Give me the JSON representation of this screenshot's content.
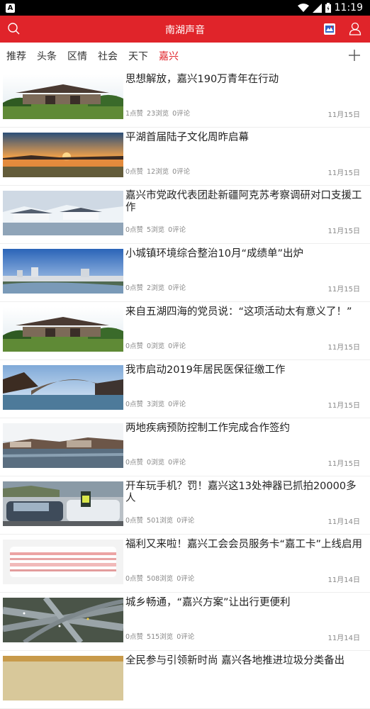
{
  "status_bar": {
    "left_icon": "A",
    "time": "11:19"
  },
  "header": {
    "title": "南湖声音"
  },
  "tabs": [
    {
      "label": "推荐"
    },
    {
      "label": "头条"
    },
    {
      "label": "区情"
    },
    {
      "label": "社会"
    },
    {
      "label": "天下"
    },
    {
      "label": "嘉兴",
      "active": true
    }
  ],
  "colors": {
    "brand_red": "#e0242a"
  },
  "news": [
    {
      "title": "思想解放，嘉兴190万青年在行动",
      "likes": "1点赞",
      "views": "23浏览",
      "comments": "0评论",
      "date": "11月15日",
      "image": "gate"
    },
    {
      "title": "平湖首届陆子文化周昨启幕",
      "likes": "0点赞",
      "views": "12浏览",
      "comments": "0评论",
      "date": "11月15日",
      "image": "sunset"
    },
    {
      "title": "嘉兴市党政代表团赴新疆阿克苏考察调研对口支援工作",
      "likes": "0点赞",
      "views": "5浏览",
      "comments": "0评论",
      "date": "11月15日",
      "image": "waterTown"
    },
    {
      "title": "小城镇环境综合整治10月“成绩单”出炉",
      "likes": "0点赞",
      "views": "2浏览",
      "comments": "0评论",
      "date": "11月15日",
      "image": "skyline"
    },
    {
      "title": "来自五湖四海的党员说：“这项活动太有意义了！”",
      "likes": "0点赞",
      "views": "0浏览",
      "comments": "0评论",
      "date": "11月15日",
      "image": "gate"
    },
    {
      "title": "我市启动2019年居民医保征缴工作",
      "likes": "0点赞",
      "views": "3浏览",
      "comments": "0评论",
      "date": "11月15日",
      "image": "bridge"
    },
    {
      "title": "两地疾病预防控制工作完成合作签约",
      "likes": "0点赞",
      "views": "0浏览",
      "comments": "0评论",
      "date": "11月15日",
      "image": "riverTown"
    },
    {
      "title": "开车玩手机？罚！嘉兴这13处神器已抓拍20000多人",
      "likes": "0点赞",
      "views": "501浏览",
      "comments": "0评论",
      "date": "11月14日",
      "image": "traffic"
    },
    {
      "title": "福利又来啦！嘉兴工会会员服务卡“嘉工卡”上线启用",
      "likes": "0点赞",
      "views": "508浏览",
      "comments": "0评论",
      "date": "11月14日",
      "image": "card"
    },
    {
      "title": "城乡畅通，“嘉兴方案”让出行更便利",
      "likes": "0点赞",
      "views": "515浏览",
      "comments": "0评论",
      "date": "11月14日",
      "image": "highway"
    },
    {
      "title": "全民参与引领新时尚 嘉兴各地推进垃圾分类备出",
      "likes": "",
      "views": "",
      "comments": "",
      "date": "",
      "image": "partial"
    }
  ]
}
